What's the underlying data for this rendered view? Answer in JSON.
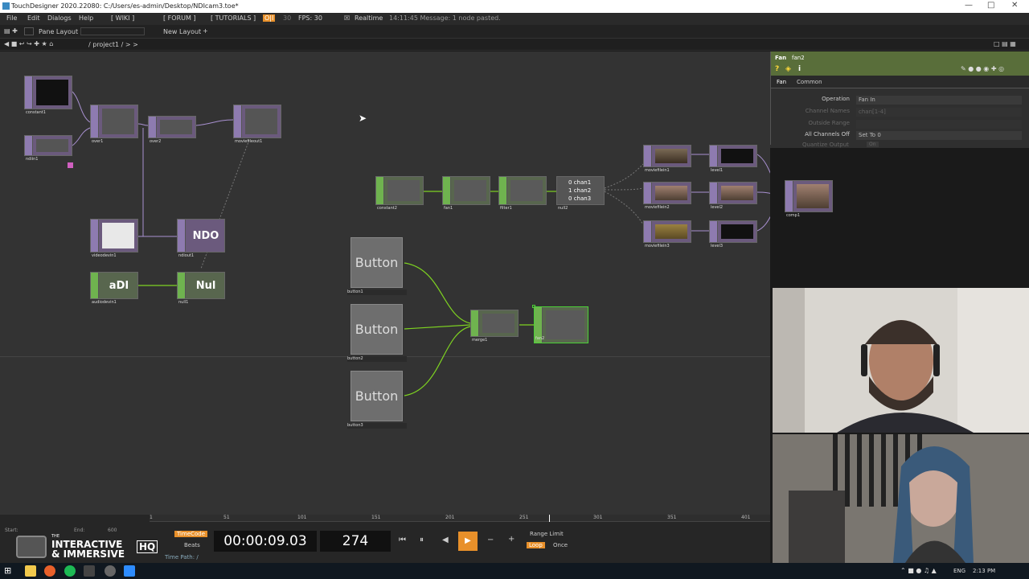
{
  "app": {
    "title": "TouchDesigner 2020.22080: C:/Users/es-admin/Desktop/NDIcam3.toe*"
  },
  "menu": {
    "items": [
      "File",
      "Edit",
      "Dialogs",
      "Help"
    ],
    "wiki": "[ WIKI ]",
    "forum": "[ FORUM ]",
    "tutorials": "[ TUTORIALS ]",
    "oi": "O|I",
    "fps_num": "30",
    "fps": "FPS: 30",
    "realtime": "Realtime",
    "message": "14:11:45 Message: 1 node pasted."
  },
  "toolbar": {
    "pane_layout": "Pane Layout",
    "new_layout": "New Layout"
  },
  "path": {
    "crumb": "/ project1 / > >"
  },
  "nodes": {
    "constant1": "constant1",
    "ndiin1": "ndiin1",
    "over1": "over1",
    "over2": "over2",
    "moviefileout1": "moviefileout1",
    "videodevin1": "videodevin1",
    "ndiout1": "ndiout1",
    "ndo_text": "NDO",
    "audiodevin1": "audiodevin1",
    "adi_text": "aDI",
    "null1": "null1",
    "nul_text": "Nul",
    "constant2": "constant2",
    "fan1": "fan1",
    "filter1": "filter1",
    "null2": "null2",
    "chans": [
      "chan1",
      "chan2",
      "chan3"
    ],
    "moviefilein1": "moviefilein1",
    "moviefilein2": "moviefilein2",
    "moviefilein3": "moviefilein3",
    "level1": "level1",
    "level2": "level2",
    "level3": "level3",
    "comp1": "comp1",
    "merge1": "merge1",
    "fan2": "fan2",
    "button_text": "Button",
    "button1": "button1",
    "button2": "button2",
    "button3": "button3"
  },
  "panel": {
    "type": "Fan",
    "name": "fan2",
    "tabs": [
      "Fan",
      "Common"
    ],
    "params": [
      {
        "label": "Operation",
        "value": "Fan In"
      },
      {
        "label": "Channel Names",
        "value": "chan[1-4]"
      },
      {
        "label": "Outside Range",
        "value": ""
      },
      {
        "label": "All Channels Off",
        "value": "Set To 0"
      },
      {
        "label": "Quantize Output",
        "value": "On"
      }
    ]
  },
  "timeline": {
    "ticks": [
      "1",
      "51",
      "101",
      "151",
      "201",
      "251",
      "301",
      "351",
      "401"
    ],
    "timecode_btn": "TimeCode",
    "beats_btn": "Beats",
    "time": "00:00:09.03",
    "frame": "274",
    "range_limit": "Range Limit",
    "loop": "Loop",
    "once": "Once",
    "time_path": "Time Path: /",
    "start": "Start:",
    "end": "End:",
    "end_val": "600",
    "logo_line1": "THE",
    "logo_line2": "INTERACTIVE",
    "logo_line3": "& IMMERSIVE",
    "logo_hq": "HQ"
  },
  "taskbar": {
    "lang": "ENG",
    "clock": "2:13 PM"
  },
  "colors": {
    "accent": "#e8902a",
    "chop_green": "#6fb34f",
    "top_purple": "#8e7bb0",
    "selected": "#4cd137"
  }
}
